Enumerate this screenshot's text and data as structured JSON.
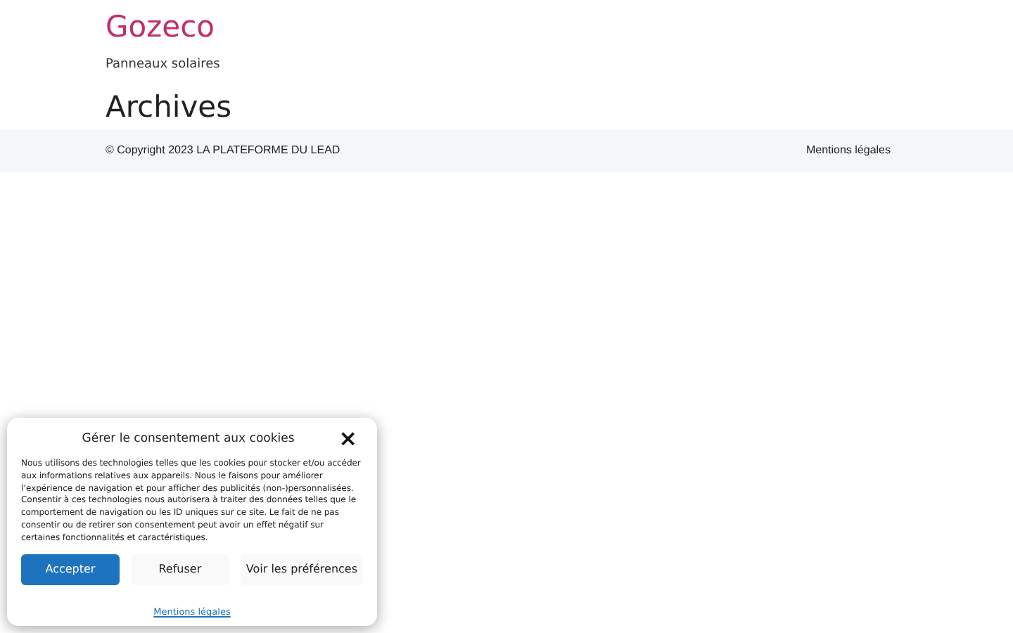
{
  "site": {
    "title": "Gozeco",
    "tagline": "Panneaux solaires"
  },
  "page": {
    "heading": "Archives"
  },
  "footer": {
    "copyright": "© Copyright 2023 LA PLATEFORME DU LEAD",
    "link": "Mentions légales"
  },
  "cookie_dialog": {
    "title": "Gérer le consentement aux cookies",
    "close": "×",
    "body": "Nous utilisons des technologies telles que les cookies pour stocker et/ou accéder aux informations relatives aux appareils. Nous le faisons pour améliorer l’expérience de navigation et pour afficher des publicités (non-)personnalisées. Consentir à ces technologies nous autorisera à traiter des données telles que le comportement de navigation ou les ID uniques sur ce site. Le fait de ne pas consentir ou de retirer son consentement peut avoir un effet négatif sur certaines fonctionnalités et caractéristiques.",
    "buttons": [
      {
        "label": "Accepter",
        "kind": "primary"
      },
      {
        "label": "Refuser",
        "kind": "secondary"
      },
      {
        "label": "Voir les préférences",
        "kind": "secondary"
      }
    ],
    "link": "Mentions légales"
  }
}
